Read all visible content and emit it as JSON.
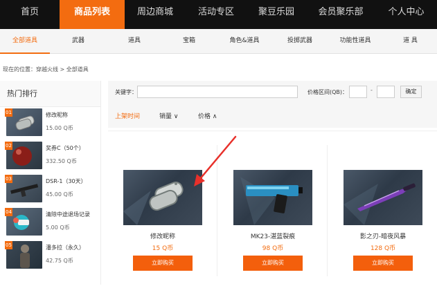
{
  "top_nav": {
    "items": [
      {
        "label": "首页"
      },
      {
        "label": "商品列表"
      },
      {
        "label": "周边商城"
      },
      {
        "label": "活动专区"
      },
      {
        "label": "聚豆乐园"
      },
      {
        "label": "会员聚乐部"
      },
      {
        "label": "个人中心"
      }
    ],
    "active_index": 1
  },
  "sub_nav": {
    "items": [
      {
        "label": "全部道具"
      },
      {
        "label": "武器"
      },
      {
        "label": "道具"
      },
      {
        "label": "宝箱"
      },
      {
        "label": "角色&道具"
      },
      {
        "label": "投掷武器"
      },
      {
        "label": "功能性道具"
      },
      {
        "label": "道 具"
      }
    ],
    "active_index": 0
  },
  "breadcrumb": "现在的位置：穿越火线 > 全部道具",
  "sidebar": {
    "title": "热门排行",
    "items": [
      {
        "rank": "01",
        "name": "修改昵称",
        "price": "15.00 Q币"
      },
      {
        "rank": "02",
        "name": "奖券C（50个）",
        "price": "332.50 Q币"
      },
      {
        "rank": "03",
        "name": "DSR-1（30天）",
        "price": "45.00 Q币"
      },
      {
        "rank": "04",
        "name": "清除中途退场记录",
        "price": "5.00 Q币"
      },
      {
        "rank": "05",
        "name": "潘多拉（永久）",
        "price": "42.75 Q币"
      }
    ]
  },
  "filter": {
    "keyword_label": "关键字：",
    "keyword_value": "",
    "price_label": "价格区间(QB)：",
    "price_dash": "-",
    "confirm_label": "确定",
    "sorts": [
      {
        "label": "上架时间"
      },
      {
        "label": "销量 ∨"
      },
      {
        "label": "价格 ∧"
      }
    ],
    "active_sort": 0
  },
  "products": [
    {
      "name": "修改昵称",
      "price": "15 Q币",
      "buy_label": "立即购买",
      "icon": "dog-tags-icon"
    },
    {
      "name": "MK23-湛蓝裂痕",
      "price": "98 Q币",
      "buy_label": "立即购买",
      "icon": "pistol-icon"
    },
    {
      "name": "影之刃-暗夜风暴",
      "price": "128 Q币",
      "buy_label": "立即购买",
      "icon": "knife-icon"
    }
  ],
  "colors": {
    "accent": "#f36c10",
    "nav_bg": "#111111",
    "subnav_bg": "#f5f5f5",
    "arrow": "#e8302a"
  }
}
